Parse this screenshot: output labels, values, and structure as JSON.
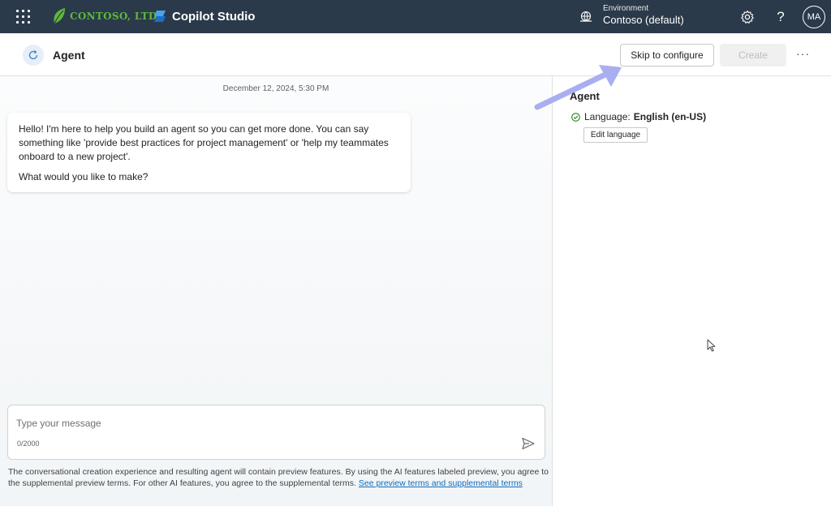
{
  "topbar": {
    "org_name": "CONTOSO, LTD.",
    "product_name": "Copilot Studio",
    "environment_label": "Environment",
    "environment_value": "Contoso (default)",
    "settings_icon": "gear-icon",
    "help_icon": "question-icon",
    "help_glyph": "?",
    "avatar_initials": "MA"
  },
  "header": {
    "title": "Agent",
    "skip_label": "Skip to configure",
    "create_label": "Create",
    "more_glyph": "···"
  },
  "chat": {
    "timestamp": "December 12, 2024, 5:30 PM",
    "message_para1": "Hello! I'm here to help you build an agent so you can get more done. You can say something like 'provide best practices for project management' or 'help my teammates onboard to a new project'.",
    "message_para2": "What would you like to make?",
    "input_placeholder": "Type your message",
    "counter": "0/2000",
    "disclaimer_text": "The conversational creation experience and resulting agent will contain preview features. By using the AI features labeled preview, you agree to the supplemental preview terms. For other AI features, you agree to the supplemental terms.",
    "disclaimer_link": "See preview terms and supplemental terms"
  },
  "side": {
    "title": "Agent",
    "language_label": "Language:",
    "language_value": "English (en-US)",
    "edit_language_label": "Edit language"
  },
  "colors": {
    "topbar_bg": "#2b3a4a",
    "brand_green": "#5fb83b",
    "link": "#0f6cbd",
    "annotation_arrow": "#a9aef0",
    "success": "#107c10"
  }
}
